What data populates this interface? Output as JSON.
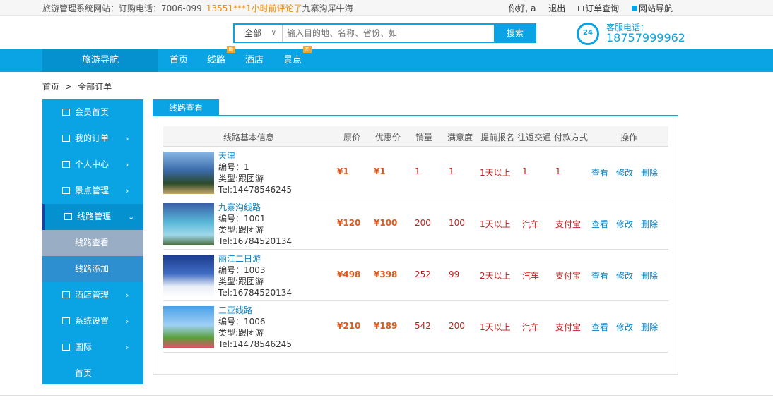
{
  "topbar": {
    "site_label": "旅游管理系统网站：订购电话：7006-099",
    "ticker_highlight": "13551***1小时前评论了",
    "ticker_rest": "九寨沟犀牛海",
    "greeting": "你好, a",
    "logout": "退出",
    "order_query": "订单查询",
    "site_nav": "网站导航"
  },
  "search": {
    "category": "全部",
    "placeholder": "输入目的地、名称、省份、如",
    "button": "搜索"
  },
  "hotline": {
    "badge": "24",
    "label": "客服电话：",
    "number": "18757999962"
  },
  "nav": {
    "guide": "旅游导航",
    "items": [
      {
        "label": "首页",
        "tag": ""
      },
      {
        "label": "线路",
        "tag": "新"
      },
      {
        "label": "酒店",
        "tag": ""
      },
      {
        "label": "景点",
        "tag": "热"
      }
    ]
  },
  "breadcrumb": {
    "home": "首页",
    "sep": ">",
    "current": "全部订单"
  },
  "sidebar": {
    "items": [
      {
        "label": "会员首页",
        "arrow": ""
      },
      {
        "label": "我的订单",
        "arrow": "›"
      },
      {
        "label": "个人中心",
        "arrow": "›"
      },
      {
        "label": "景点管理",
        "arrow": "›"
      },
      {
        "label": "线路管理",
        "arrow": "⌄"
      },
      {
        "label": "线路查看"
      },
      {
        "label": "线路添加"
      },
      {
        "label": "酒店管理",
        "arrow": "›"
      },
      {
        "label": "系统设置",
        "arrow": "›"
      },
      {
        "label": "国际",
        "arrow": "›"
      },
      {
        "label": "首页"
      }
    ]
  },
  "tab": {
    "label": "线路查看"
  },
  "table": {
    "headers": [
      "线路基本信息",
      "原价",
      "优惠价",
      "销量",
      "满意度",
      "提前报名",
      "往返交通",
      "付款方式",
      "操作"
    ],
    "rows": [
      {
        "name": "天津",
        "code": "编号：1",
        "type": "类型:跟团游",
        "tel": "Tel:14478546245",
        "price": "¥1",
        "discount": "¥1",
        "sales": "1",
        "satisfaction": "1",
        "advance": "1天以上",
        "transport": "1",
        "payment": "1",
        "view": "查看",
        "edit": "修改",
        "delete": "删除",
        "palette": [
          "#87b8e6",
          "#3a6aa8",
          "#2b4a2a",
          "#c9a66b"
        ]
      },
      {
        "name": "九寨沟线路",
        "code": "编号：1001",
        "type": "类型:跟团游",
        "tel": "Tel:16784520134",
        "price": "¥120",
        "discount": "¥100",
        "sales": "200",
        "satisfaction": "100",
        "advance": "1天以上",
        "transport": "汽车",
        "payment": "支付宝",
        "view": "查看",
        "edit": "修改",
        "delete": "删除",
        "palette": [
          "#3a5fa8",
          "#58b8d8",
          "#9fd8ea",
          "#4a6b3a"
        ]
      },
      {
        "name": "丽江二日游",
        "code": "编号：1003",
        "type": "类型:跟团游",
        "tel": "Tel:16784520134",
        "price": "¥498",
        "discount": "¥398",
        "sales": "252",
        "satisfaction": "99",
        "advance": "2天以上",
        "transport": "汽车",
        "payment": "支付宝",
        "view": "查看",
        "edit": "修改",
        "delete": "删除",
        "palette": [
          "#1c3a8a",
          "#3f6cc4",
          "#e8eef6",
          "#ffffff"
        ]
      },
      {
        "name": "三亚线路",
        "code": "编号：1006",
        "type": "类型:跟团游",
        "tel": "Tel:14478546245",
        "price": "¥210",
        "discount": "¥189",
        "sales": "542",
        "satisfaction": "200",
        "advance": "1天以上",
        "transport": "汽车",
        "payment": "支付宝",
        "view": "查看",
        "edit": "修改",
        "delete": "删除",
        "palette": [
          "#4aa0e8",
          "#9fd0f5",
          "#5aa03a",
          "#e84a6a"
        ]
      }
    ]
  }
}
